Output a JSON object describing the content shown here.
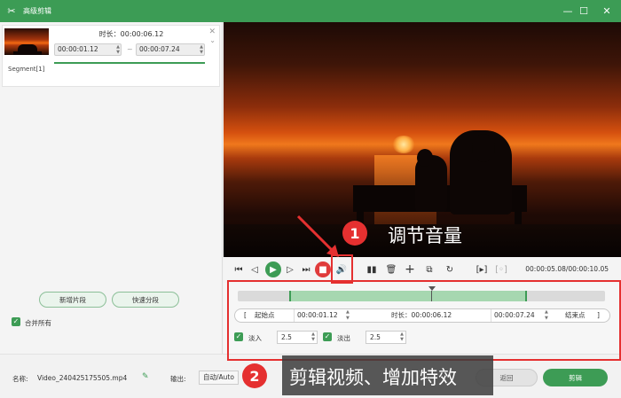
{
  "window": {
    "title": "高级剪辑",
    "icon": "app-logo-icon",
    "controls": [
      "minimize-icon",
      "maximize-icon",
      "close-icon"
    ]
  },
  "colors": {
    "brand": "#3c9c55",
    "accent_red": "#e53030",
    "play_green": "#3d9c55",
    "stop_red": "#e03b3b"
  },
  "segment": {
    "duration_label": "时长：00:00:06.12",
    "start": "00:00:01.12",
    "end": "00:00:07.24",
    "tilde": "~",
    "name": "Segment[1]"
  },
  "left_actions": {
    "new_segment": "新增片段",
    "quick_split": "快速分段",
    "merge_all": "合并所有"
  },
  "player": {
    "timecode": "00:00:05.08/00:00:10.05"
  },
  "trim": {
    "start_bracket": "[",
    "start_label": "起始点",
    "start_value": "00:00:01.12",
    "duration": "时长：00:00:06.12",
    "end_value": "00:00:07.24",
    "end_label": "结束点",
    "end_bracket": "]"
  },
  "fade": {
    "fade_in_label": "淡入",
    "fade_in_value": "2.5",
    "fade_out_label": "淡出",
    "fade_out_value": "2.5"
  },
  "bottom": {
    "name_label": "名称:",
    "filename": "Video_240425175505.mp4",
    "output_label": "输出:",
    "output_value": "自动/Auto",
    "back_button": "返回",
    "cut_button": "剪辑"
  },
  "annotations": {
    "badge1": "1",
    "caption1": "调节音量",
    "badge2": "2",
    "caption2": "剪辑视频、增加特效"
  }
}
